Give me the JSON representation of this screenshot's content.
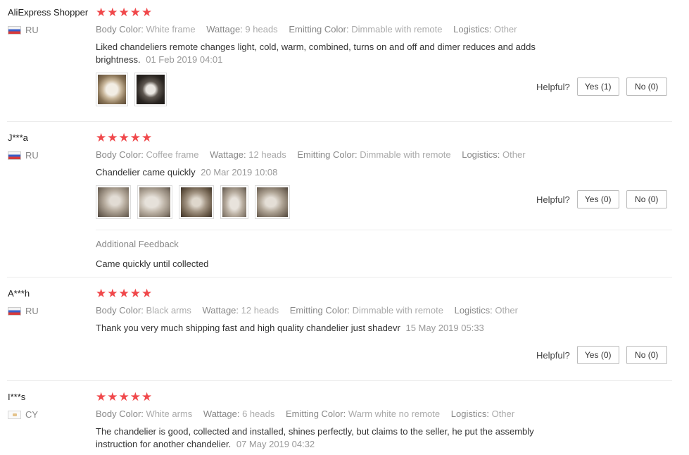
{
  "reviews": [
    {
      "user": "AliExpress Shopper",
      "country": "RU",
      "flag": "ru",
      "attrs": [
        {
          "label": "Body Color:",
          "value": "White frame"
        },
        {
          "label": "Wattage:",
          "value": "9 heads"
        },
        {
          "label": "Emitting Color:",
          "value": "Dimmable with remote"
        },
        {
          "label": "Logistics:",
          "value": "Other"
        }
      ],
      "text": "Liked chandeliers remote changes light, cold, warm, combined, turns on and off and dimer reduces and adds brightness.",
      "date": "01 Feb 2019 04:01",
      "helpful_label": "Helpful?",
      "yes": "Yes (1)",
      "no": "No (0)"
    },
    {
      "user": "J***a",
      "country": "RU",
      "flag": "ru",
      "attrs": [
        {
          "label": "Body Color:",
          "value": "Coffee frame"
        },
        {
          "label": "Wattage:",
          "value": "12 heads"
        },
        {
          "label": "Emitting Color:",
          "value": "Dimmable with remote"
        },
        {
          "label": "Logistics:",
          "value": "Other"
        }
      ],
      "text": "Chandelier came quickly",
      "date": "20 Mar 2019 10:08",
      "helpful_label": "Helpful?",
      "yes": "Yes (0)",
      "no": "No (0)",
      "additional_title": "Additional Feedback",
      "additional_text": "Came quickly until collected"
    },
    {
      "user": "A***h",
      "country": "RU",
      "flag": "ru",
      "attrs": [
        {
          "label": "Body Color:",
          "value": "Black arms"
        },
        {
          "label": "Wattage:",
          "value": "12 heads"
        },
        {
          "label": "Emitting Color:",
          "value": "Dimmable with remote"
        },
        {
          "label": "Logistics:",
          "value": "Other"
        }
      ],
      "text": "Thank you very much shipping fast and high quality chandelier just shadevr",
      "date": "15 May 2019 05:33",
      "helpful_label": "Helpful?",
      "yes": "Yes (0)",
      "no": "No (0)"
    },
    {
      "user": "I***s",
      "country": "CY",
      "flag": "cy",
      "attrs": [
        {
          "label": "Body Color:",
          "value": "White arms"
        },
        {
          "label": "Wattage:",
          "value": "6 heads"
        },
        {
          "label": "Emitting Color:",
          "value": "Warm white no remote"
        },
        {
          "label": "Logistics:",
          "value": "Other"
        }
      ],
      "text": "The chandelier is good, collected and installed, shines perfectly, but claims to the seller, he put the assembly instruction for another chandelier.",
      "date": "07 May 2019 04:32"
    }
  ],
  "colors": {
    "star": "#f0484b",
    "muted": "#999999",
    "divider": "#ececec"
  },
  "rating_icon": "star-icon"
}
